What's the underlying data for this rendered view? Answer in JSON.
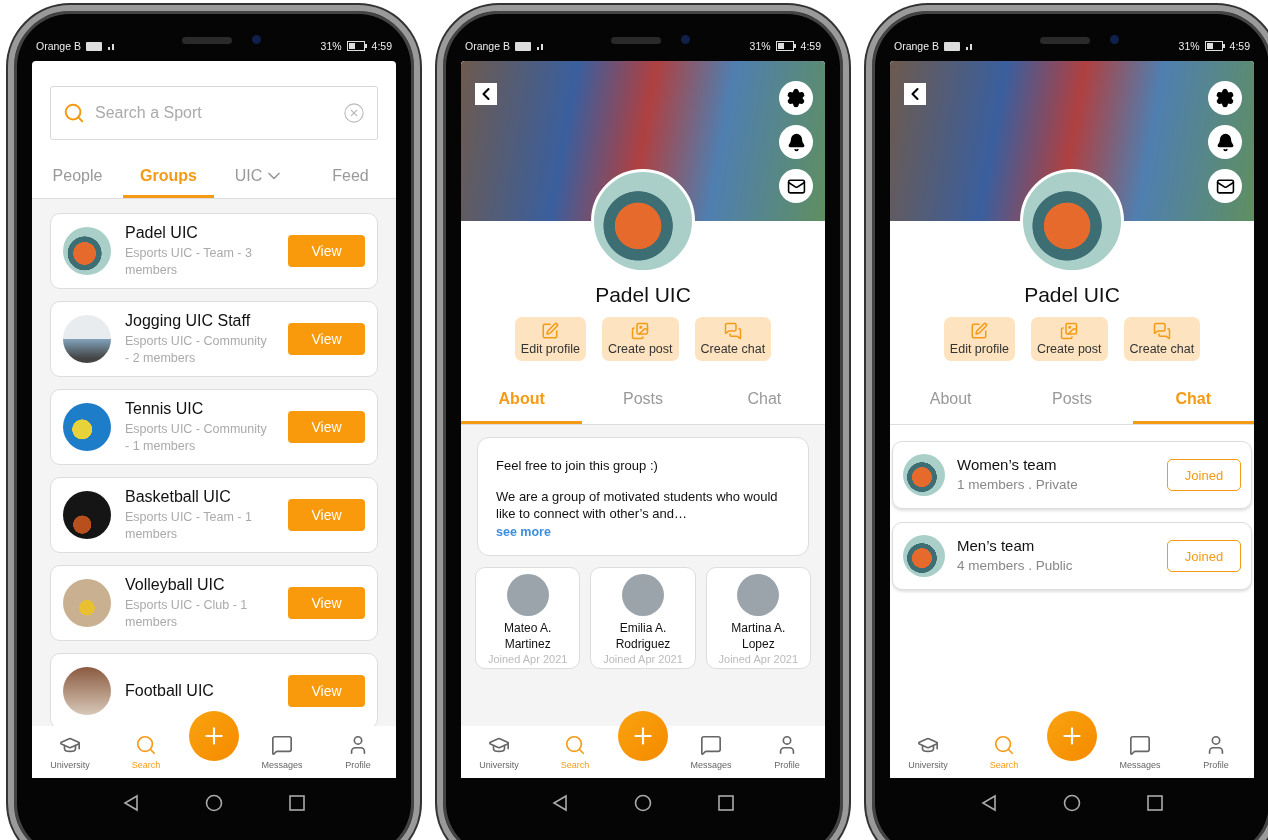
{
  "phones": [
    {
      "kind": "search",
      "status_bar": {
        "carrier": "Orange B",
        "battery": "31%",
        "time": "4:59"
      },
      "search": {
        "placeholder": "Search a Sport"
      },
      "tabs": [
        {
          "label": "People",
          "selected": false,
          "dropdown": false
        },
        {
          "label": "Groups",
          "selected": true,
          "dropdown": false
        },
        {
          "label": "UIC",
          "selected": false,
          "dropdown": true
        },
        {
          "label": "Feed",
          "selected": false,
          "dropdown": false
        }
      ],
      "groups": [
        {
          "name": "Padel UIC",
          "meta": "Esports UIC  - Team - 3 members",
          "button": "View"
        },
        {
          "name": "Jogging UIC Staff",
          "meta": "Esports UIC  - Community - 2 members",
          "button": "View"
        },
        {
          "name": "Tennis UIC",
          "meta": "Esports UIC  - Community - 1 members",
          "button": "View"
        },
        {
          "name": "Basketball UIC",
          "meta": "Esports UIC  - Team - 1 members",
          "button": "View"
        },
        {
          "name": "Volleyball UIC",
          "meta": "Esports UIC  - Club - 1 members",
          "button": "View"
        },
        {
          "name": "Football UIC",
          "button": "View"
        }
      ],
      "nav": [
        {
          "label": "University",
          "selected": false
        },
        {
          "label": "Search",
          "selected": true
        },
        {
          "label": "Messages",
          "selected": false
        },
        {
          "label": "Profile",
          "selected": false
        }
      ]
    },
    {
      "kind": "group",
      "status_bar": {
        "carrier": "Orange B",
        "battery": "31%",
        "time": "4:59"
      },
      "title": "Padel UIC",
      "actions": [
        "Edit profile",
        "Create post",
        "Create chat"
      ],
      "tabs": [
        {
          "label": "About",
          "selected": true
        },
        {
          "label": "Posts",
          "selected": false
        },
        {
          "label": "Chat",
          "selected": false
        }
      ],
      "about": {
        "lines": [
          "Feel free to join this group :)",
          "We are a group of motivated students who would like to connect with other’s and…"
        ],
        "link": "see more"
      },
      "members": [
        {
          "first": "Mateo A.",
          "last": "Martinez",
          "joined": "Joined Apr 2021"
        },
        {
          "first": "Emilia A.",
          "last": "Rodriguez",
          "joined": "Joined Apr 2021"
        },
        {
          "first": "Martina A.",
          "last": "Lopez",
          "joined": "Joined Apr 2021"
        }
      ],
      "nav": [
        {
          "label": "University",
          "selected": false
        },
        {
          "label": "Search",
          "selected": true
        },
        {
          "label": "Messages",
          "selected": false
        },
        {
          "label": "Profile",
          "selected": false
        }
      ]
    },
    {
      "kind": "group",
      "status_bar": {
        "carrier": "Orange B",
        "battery": "31%",
        "time": "4:59"
      },
      "title": "Padel UIC",
      "actions": [
        "Edit profile",
        "Create post",
        "Create chat"
      ],
      "tabs": [
        {
          "label": "About",
          "selected": false
        },
        {
          "label": "Posts",
          "selected": false
        },
        {
          "label": "Chat",
          "selected": true
        }
      ],
      "chats": [
        {
          "name": "Women’s team",
          "meta": "1 members . Private",
          "button": "Joined"
        },
        {
          "name": "Men’s team",
          "meta": "4 members . Public",
          "button": "Joined"
        }
      ],
      "nav": [
        {
          "label": "University",
          "selected": false
        },
        {
          "label": "Search",
          "selected": true
        },
        {
          "label": "Messages",
          "selected": false
        },
        {
          "label": "Profile",
          "selected": false
        }
      ]
    }
  ]
}
